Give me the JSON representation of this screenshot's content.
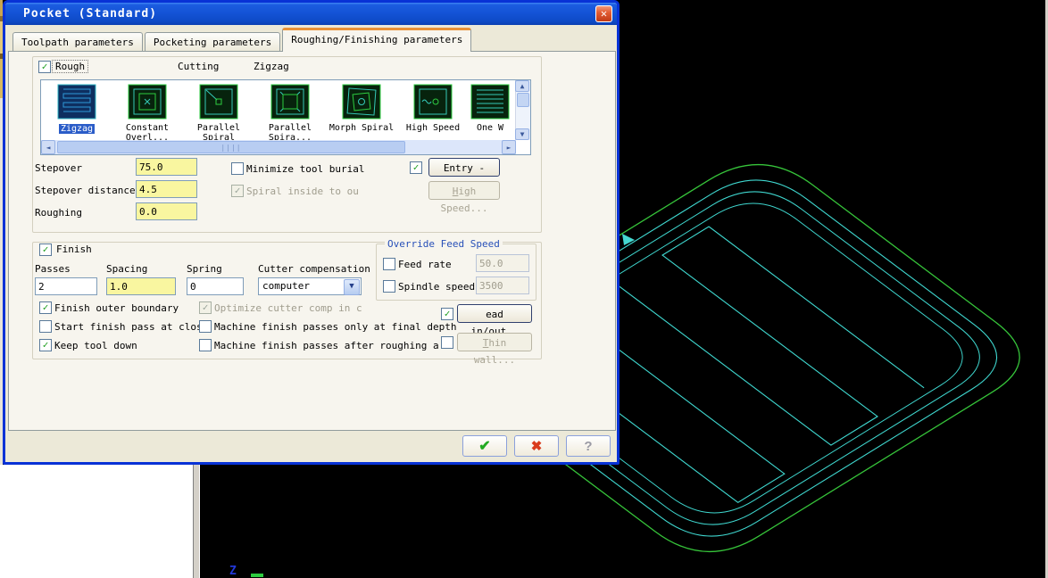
{
  "window": {
    "title": "Pocket (Standard)",
    "close_icon": "✕"
  },
  "tabs": {
    "items": [
      {
        "label": "Toolpath parameters"
      },
      {
        "label": "Pocketing parameters"
      },
      {
        "label": "Roughing/Finishing parameters"
      }
    ],
    "active": "Roughing/Finishing parameters"
  },
  "rough": {
    "checkbox_label": "Rough",
    "checked": true,
    "cutting_label": "Cutting",
    "selected_method": "Zigzag",
    "methods": [
      {
        "label": "Zigzag",
        "selected": true
      },
      {
        "label": "Constant\nOverl..."
      },
      {
        "label": "Parallel\nSpiral"
      },
      {
        "label": "Parallel\nSpira..."
      },
      {
        "label": "Morph Spiral"
      },
      {
        "label": "High Speed"
      },
      {
        "label": "One W"
      }
    ],
    "fields": {
      "stepover": {
        "label": "Stepover",
        "value": "75.0"
      },
      "stepover_distance": {
        "label": "Stepover distance",
        "value": "4.5"
      },
      "roughing": {
        "label": "Roughing",
        "value": "0.0"
      }
    },
    "minimize_tool_burial": {
      "label": "Minimize tool burial",
      "checked": false
    },
    "spiral_inside": {
      "label": "Spiral inside to ou",
      "checked": true,
      "disabled": true
    },
    "entry_ramp": {
      "label": "Entry - ramp",
      "checked": true
    },
    "high_speed_button": {
      "label": "High Speed...",
      "disabled": true
    }
  },
  "finish": {
    "checkbox_label": "Finish",
    "checked": true,
    "passes": {
      "label": "Passes",
      "value": "2"
    },
    "spacing": {
      "label": "Spacing",
      "value": "1.0"
    },
    "spring": {
      "label": "Spring",
      "value": "0"
    },
    "cutter_compensation": {
      "label": "Cutter compensation",
      "value": "computer"
    },
    "finish_outer_boundary": {
      "label": "Finish outer boundary",
      "checked": true
    },
    "optimize_cutter_comp": {
      "label": "Optimize cutter comp in c",
      "checked": true,
      "disabled": true
    },
    "start_finish_pass": {
      "label": "Start finish pass at close",
      "checked": false
    },
    "machine_only_final_depth": {
      "label": "Machine finish passes only at final depth",
      "checked": false
    },
    "keep_tool_down": {
      "label": "Keep tool down",
      "checked": true
    },
    "machine_after_roughing": {
      "label": "Machine finish passes after roughing all p",
      "checked": false
    },
    "lead_in_out": {
      "label": "ead in/out..",
      "checked": true
    },
    "thin_wall": {
      "label": "Thin wall...",
      "checked": false,
      "disabled": true
    }
  },
  "override_feed_speed": {
    "title": "Override Feed Speed",
    "feed_rate": {
      "label": "Feed rate",
      "value": "50.0",
      "checked": false
    },
    "spindle_speed": {
      "label": "Spindle speed",
      "value": "3500",
      "checked": false
    }
  },
  "footer": {
    "ok_icon": "✔",
    "cancel_icon": "✖",
    "help_icon": "?"
  },
  "viewport": {
    "z_axis_label": "Z"
  },
  "colors": {
    "input_yellow": "#f9f6a0",
    "selection_blue": "#2a5cc8",
    "cad_green": "#36c43a",
    "cad_cyan": "#3fd8d0",
    "titlebar_blue": "#1453d6",
    "group_title_blue": "#2850b8"
  }
}
